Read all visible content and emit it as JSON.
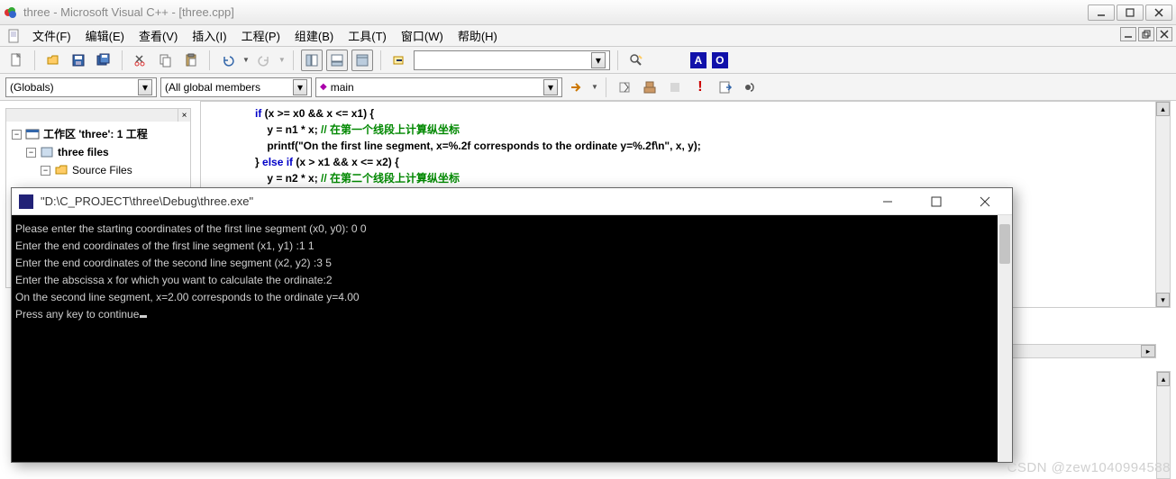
{
  "window": {
    "title": "three - Microsoft Visual C++ - [three.cpp]"
  },
  "menus": {
    "file": "文件(F)",
    "edit": "编辑(E)",
    "view": "查看(V)",
    "insert": "插入(I)",
    "project": "工程(P)",
    "build": "组建(B)",
    "tools": "工具(T)",
    "window": "窗口(W)",
    "help": "帮助(H)"
  },
  "combos": {
    "globals": "(Globals)",
    "members": "(All global members",
    "main_prefix": "◆",
    "main": "main",
    "search": ""
  },
  "workspace": {
    "root": "工作区 'three': 1 工程",
    "project": "three files",
    "folder": "Source Files"
  },
  "code": {
    "l1a": "if",
    "l1b": " (x >= x0 && x <= x1) {",
    "l2a": "    y = n1 * x; ",
    "l2b": "// 在第一个线段上计算纵坐标",
    "l3": "    printf(\"On the first line segment, x=%.2f corresponds to the ordinate y=%.2f\\n\", x, y);",
    "l4a": "} ",
    "l4b": "else if",
    "l4c": " (x > x1 && x <= x2) {",
    "l5a": "    y = n2 * x; ",
    "l5b": "// 在第二个线段上计算纵坐标"
  },
  "console": {
    "title": "\"D:\\C_PROJECT\\three\\Debug\\three.exe\"",
    "line1": "Please enter the starting coordinates of the first line segment (x0, y0): 0 0",
    "line2": "Enter the end coordinates of the first line segment (x1, y1) :1 1",
    "line3": "Enter the end coordinates of the second line segment (x2, y2) :3 5",
    "line4": "Enter the abscissa x for which you want to calculate the ordinate:2",
    "line5": "On the second line segment, x=2.00 corresponds to the ordinate y=4.00",
    "line6": "Press any key to continue"
  },
  "watermark": "CSDN @zew1040994588",
  "badges": {
    "a": "A",
    "o": "O"
  }
}
